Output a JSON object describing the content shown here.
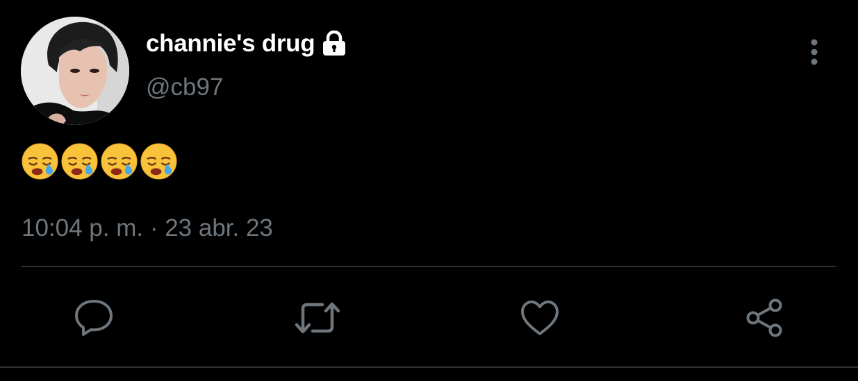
{
  "tweet": {
    "display_name": "channie's drug",
    "handle": "@cb97",
    "protected_icon": "lock-icon",
    "text_emojis": [
      "sleepy-face",
      "sleepy-face",
      "sleepy-face",
      "sleepy-face"
    ],
    "timestamp": "10:04 p. m. · 23 abr. 23"
  },
  "actions": [
    {
      "name": "reply",
      "icon": "speech-bubble-icon"
    },
    {
      "name": "retweet",
      "icon": "retweet-arrows-icon"
    },
    {
      "name": "like",
      "icon": "heart-icon"
    },
    {
      "name": "share",
      "icon": "share-nodes-icon"
    }
  ],
  "colors": {
    "background": "#000000",
    "primary_text": "#ffffff",
    "secondary_text": "#6e767d",
    "divider": "#2f3336",
    "icon": "#6e767d"
  }
}
